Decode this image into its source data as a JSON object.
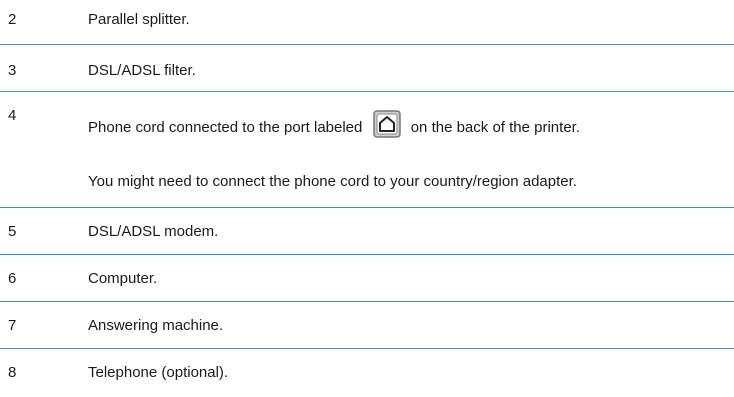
{
  "rows": [
    {
      "number": "2",
      "description": "Parallel splitter."
    },
    {
      "number": "3",
      "description": "DSL/ADSL filter."
    },
    {
      "number": "4",
      "description_before_icon": "Phone cord connected to the port labeled",
      "icon": "phone-port-icon",
      "description_after_icon": "on the back of the printer.",
      "note": "You might need to connect the phone cord to your country/region adapter."
    },
    {
      "number": "5",
      "description": "DSL/ADSL modem."
    },
    {
      "number": "6",
      "description": "Computer."
    },
    {
      "number": "7",
      "description": "Answering machine."
    },
    {
      "number": "8",
      "description": "Telephone (optional)."
    }
  ],
  "colors": {
    "divider": "#3a8fc8",
    "text": "#1a1a1a"
  }
}
